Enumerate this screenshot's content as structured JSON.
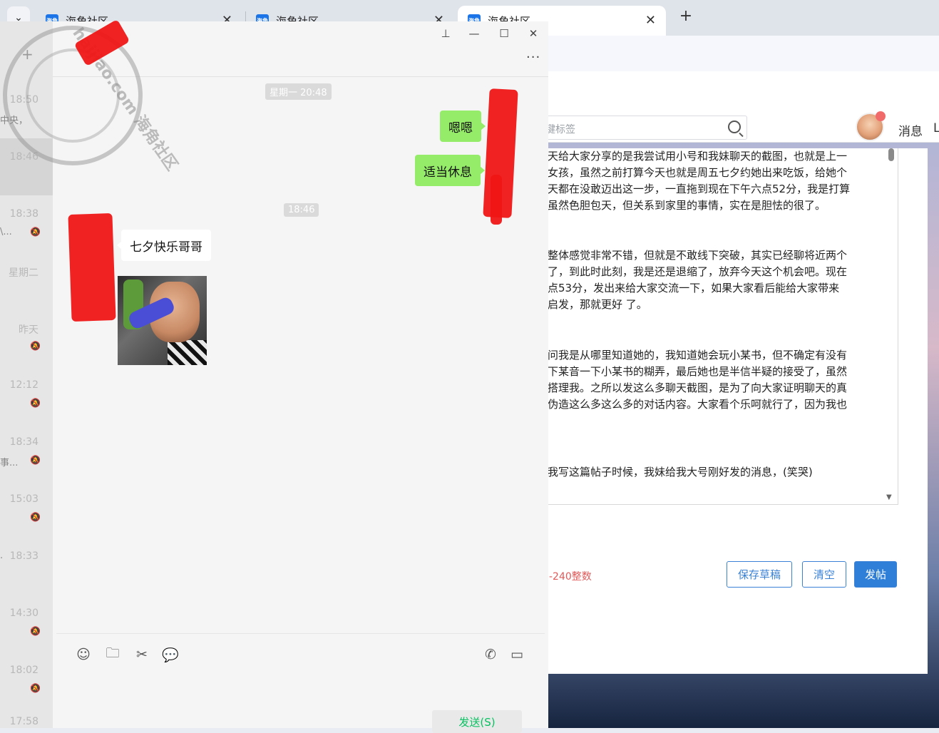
{
  "browser": {
    "tabs": [
      {
        "title": "海角社区",
        "favicon": "海角"
      },
      {
        "title": "海角社区",
        "favicon": "海角"
      },
      {
        "title": "海角社区",
        "favicon": "海角"
      }
    ],
    "close_glyph": "✕",
    "new_tab_glyph": "+",
    "dropdown_glyph": "⌄"
  },
  "forum": {
    "search_placeholder": "键标签",
    "nav_messages": "消息",
    "nav_overflow": "Ц",
    "paragraphs": [
      [
        "天给大家分享的是我尝试用小号和我妹聊天的截图，也就是上一",
        "女孩，虽然之前打算今天也就是周五七夕约她出来吃饭，给她个",
        "天都在没敢迈出这一步，一直拖到现在下午六点52分，我是打算",
        "虽然色胆包天，但关系到家里的事情，实在是胆怯的很了。"
      ],
      [
        "整体感觉非常不错，但就是不敢线下突破，其实已经聊将近两个",
        "了，到此时此刻，我是还是退缩了，放弃今天这个机会吧。现在",
        "点53分，发出来给大家交流一下，如果大家看后能给大家带来",
        "启发，那就更好 了。"
      ],
      [
        "问我是从哪里知道她的，我知道她会玩小某书，但不确定有没有",
        "下某音一下小某书的糊弄，最后她也是半信半疑的接受了，虽然",
        "搭理我。之所以发这么多聊天截图，是为了向大家证明聊天的真",
        "伪造这么多这么多的对话内容。大家看个乐呵就行了，因为我也"
      ],
      [
        "我写这篇帖子时候，我妹给我大号刚好发的消息，(笑哭)"
      ]
    ],
    "hint": "-240整数",
    "buttons": {
      "save_draft": "保存草稿",
      "clear": "清空",
      "post": "发帖"
    }
  },
  "chat_list": {
    "plus": "+",
    "items": [
      {
        "time": "18:50",
        "snippet": "中央，",
        "muted": false
      },
      {
        "time": "18:46",
        "snippet": "",
        "muted": false
      },
      {
        "time": "18:38",
        "snippet": "\\...",
        "muted": true
      },
      {
        "time": "星期二",
        "snippet": "",
        "muted": false
      },
      {
        "time": "昨天",
        "snippet": "",
        "muted": true
      },
      {
        "time": "12:12",
        "snippet": "",
        "muted": true
      },
      {
        "time": "18:34",
        "snippet": "事...",
        "muted": true
      },
      {
        "time": "15:03",
        "snippet": "",
        "muted": true
      },
      {
        "time": "18:33",
        "snippet": ".",
        "muted": false
      },
      {
        "time": "14:30",
        "snippet": "",
        "muted": true
      },
      {
        "time": "18:02",
        "snippet": "",
        "muted": true
      },
      {
        "time": "17:58",
        "snippet": "",
        "muted": false
      }
    ]
  },
  "chat": {
    "controls": {
      "pin": "⊥",
      "minimize": "—",
      "maximize": "☐",
      "close": "✕",
      "more": "···"
    },
    "timestamp_1": "星期一 20:48",
    "timestamp_2": "18:46",
    "messages": [
      {
        "from": "me",
        "text": "嗯嗯"
      },
      {
        "from": "me",
        "text": "适当休息"
      },
      {
        "from": "them",
        "text": "七夕快乐哥哥"
      }
    ],
    "send_label": "发送(S)"
  },
  "watermark": {
    "text": "haijiao.com 海角社区"
  },
  "colors": {
    "my_bubble": "#95ec69",
    "accent_blue": "#2f7fd9",
    "send_green": "#07c160",
    "scribble_red": "#f01616"
  }
}
